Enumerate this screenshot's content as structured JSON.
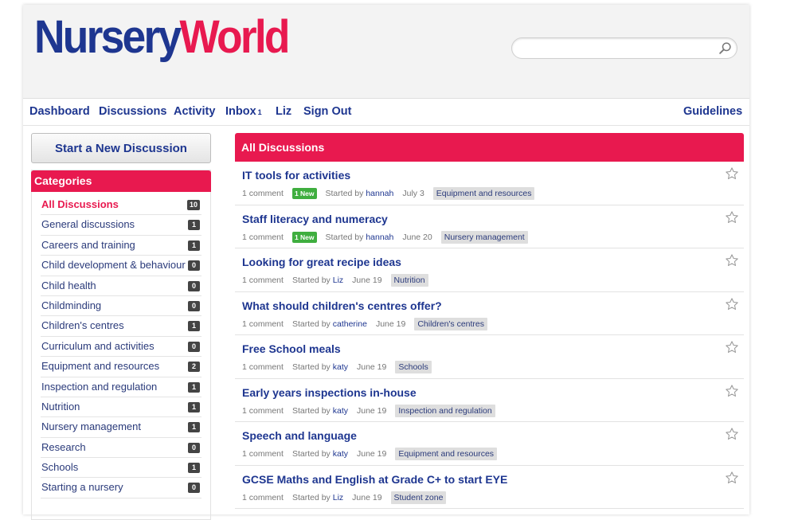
{
  "brand": {
    "part1": "Nursery",
    "part2": "World"
  },
  "search": {
    "placeholder": "",
    "value": ""
  },
  "nav": {
    "dashboard": "Dashboard",
    "discussions": "Discussions",
    "activity": "Activity",
    "inbox": "Inbox",
    "inbox_count": "1",
    "user": "Liz",
    "sign_out": "Sign Out",
    "guidelines": "Guidelines"
  },
  "sidebar": {
    "new_discussion": "Start a New Discussion",
    "categories_title": "Categories",
    "items": [
      {
        "label": "All Discussions",
        "count": "10"
      },
      {
        "label": "General discussions",
        "count": "1"
      },
      {
        "label": "Careers and training",
        "count": "1"
      },
      {
        "label": "Child development & behaviour",
        "count": "0"
      },
      {
        "label": "Child health",
        "count": "0"
      },
      {
        "label": "Childminding",
        "count": "0"
      },
      {
        "label": "Children's centres",
        "count": "1"
      },
      {
        "label": "Curriculum and activities",
        "count": "0"
      },
      {
        "label": "Equipment and resources",
        "count": "2"
      },
      {
        "label": "Inspection and regulation",
        "count": "1"
      },
      {
        "label": "Nutrition",
        "count": "1"
      },
      {
        "label": "Nursery management",
        "count": "1"
      },
      {
        "label": "Research",
        "count": "0"
      },
      {
        "label": "Schools",
        "count": "1"
      },
      {
        "label": "Starting a nursery",
        "count": "0"
      }
    ]
  },
  "main": {
    "title": "All Discussions",
    "started_by": "Started by",
    "discussions": [
      {
        "title": "IT tools for activities",
        "comments": "1 comment",
        "new": "1 New",
        "author": "hannah",
        "date": "July 3",
        "tag": "Equipment and resources"
      },
      {
        "title": "Staff literacy and numeracy",
        "comments": "1 comment",
        "new": "1 New",
        "author": "hannah",
        "date": "June 20",
        "tag": "Nursery management"
      },
      {
        "title": "Looking for great recipe ideas",
        "comments": "1 comment",
        "new": "",
        "author": "Liz",
        "date": "June 19",
        "tag": "Nutrition"
      },
      {
        "title": "What should children's centres offer?",
        "comments": "1 comment",
        "new": "",
        "author": "catherine",
        "date": "June 19",
        "tag": "Children's centres"
      },
      {
        "title": "Free School meals",
        "comments": "1 comment",
        "new": "",
        "author": "katy",
        "date": "June 19",
        "tag": "Schools"
      },
      {
        "title": "Early years inspections in-house",
        "comments": "1 comment",
        "new": "",
        "author": "katy",
        "date": "June 19",
        "tag": "Inspection and regulation"
      },
      {
        "title": "Speech and language",
        "comments": "1 comment",
        "new": "",
        "author": "katy",
        "date": "June 19",
        "tag": "Equipment and resources"
      },
      {
        "title": "GCSE Maths and English at Grade C+ to start EYE",
        "comments": "1 comment",
        "new": "",
        "author": "Liz",
        "date": "June 19",
        "tag": "Student zone"
      }
    ]
  },
  "colors": {
    "brand_blue": "#1e3690",
    "brand_pink": "#e8194f",
    "new_green": "#3fae3f"
  },
  "icons": {
    "search": "magnifier-icon",
    "star": "star-outline-icon"
  }
}
